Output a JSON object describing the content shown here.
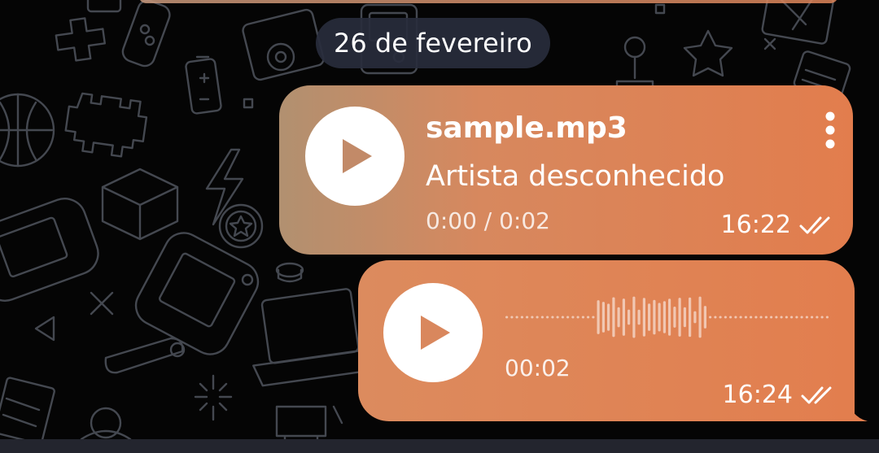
{
  "chat": {
    "date_separator": "26 de fevereiro",
    "audio_message": {
      "file_name": "sample.mp3",
      "artist": "Artista desconhecido",
      "progress": "0:00 / 0:02",
      "time": "16:22",
      "play_icon": "play-icon",
      "menu_icon": "more-vertical-icon",
      "status_icon": "double-check-icon"
    },
    "voice_message": {
      "duration": "00:02",
      "time": "16:24",
      "play_icon": "play-icon",
      "status_icon": "double-check-icon"
    }
  },
  "colors": {
    "bubble_start": "#b19070",
    "bubble_end": "#e27d4d",
    "play_glyph": "#d9875d",
    "date_pill": "#282c3c",
    "wallpaper_doodle": "#5a5f6a"
  }
}
